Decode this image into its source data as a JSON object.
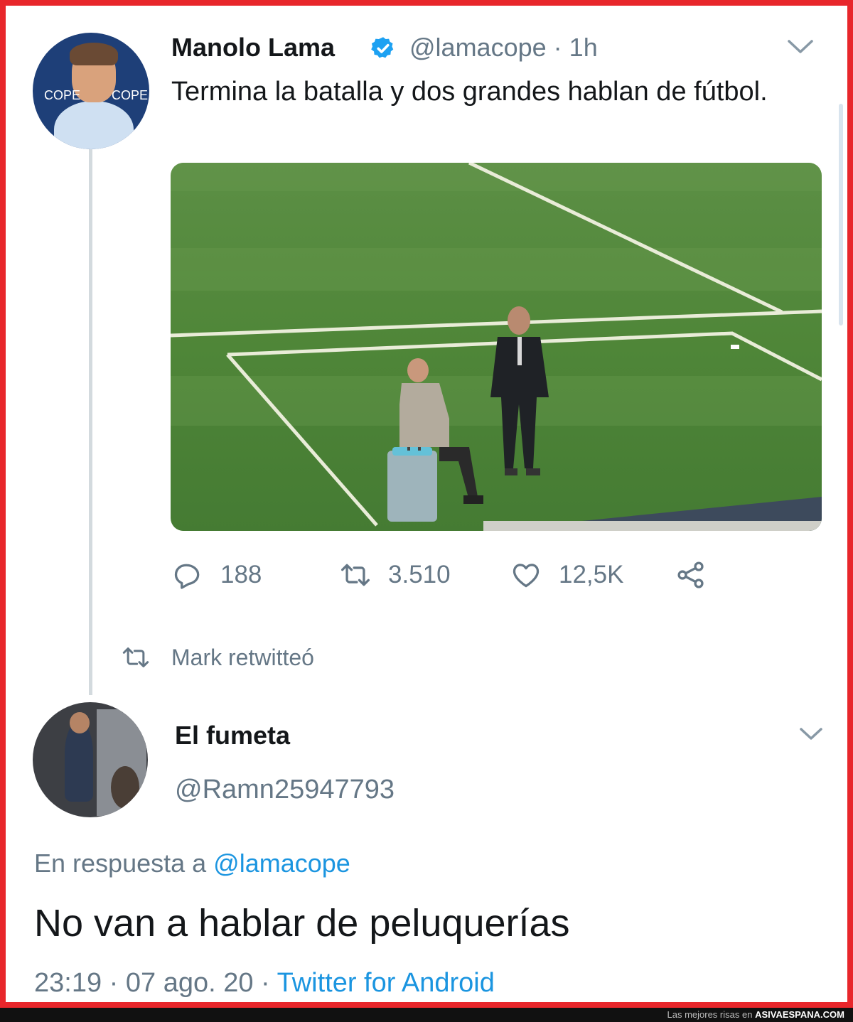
{
  "tweet": {
    "author_name": "Manolo Lama",
    "handle": "@lamacope",
    "separator": "·",
    "time": "1h",
    "text": "Termina la batalla y dos grandes hablan de fútbol.",
    "avatar_text_left": "COPE",
    "avatar_text_right": "COPE",
    "stats": {
      "replies": "188",
      "retweets": "3.510",
      "likes": "12,5K"
    }
  },
  "retweet_notice": "Mark retwitteó",
  "reply": {
    "author_name": "El fumeta",
    "handle": "@Ramn25947793",
    "reply_prefix": "En respuesta a",
    "reply_mention": "@lamacope",
    "text": "No van a hablar de peluquerías",
    "time": "23:19",
    "separator": "·",
    "date": "07 ago. 20",
    "separator2": "·",
    "source": "Twitter for Android"
  },
  "footer": {
    "tagline": "Las mejores risas en",
    "brand": "ASIVAESPANA.COM"
  },
  "colors": {
    "border": "#e8262b",
    "text": "#14171a",
    "secondary": "#657786",
    "link": "#1b95e0",
    "verified": "#1da1f2"
  },
  "icons": [
    "verified-badge-icon",
    "chevron-down-icon",
    "reply-icon",
    "retweet-icon",
    "like-icon",
    "share-icon"
  ]
}
